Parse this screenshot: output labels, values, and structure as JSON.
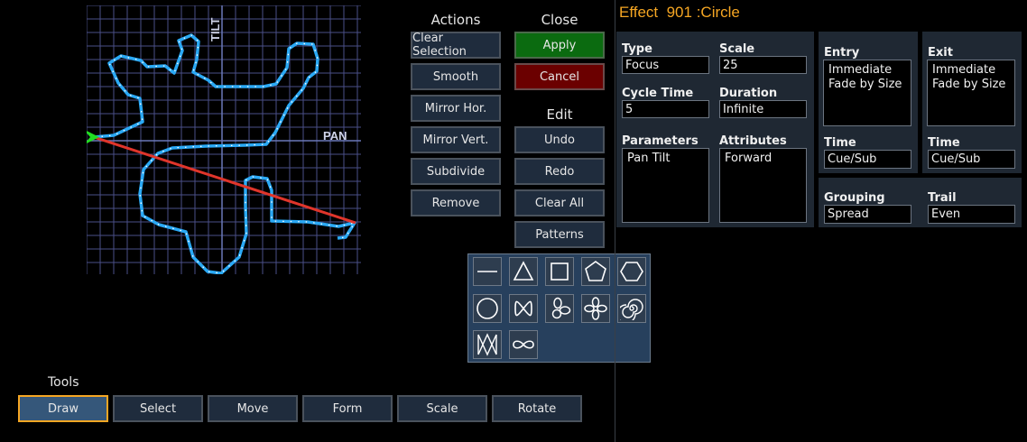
{
  "grid": {
    "tilt_label": "TILT",
    "pan_label": "PAN"
  },
  "actions": {
    "title": "Actions",
    "buttons": [
      "Clear Selection",
      "Smooth",
      "Mirror Hor.",
      "Mirror Vert.",
      "Subdivide",
      "Remove"
    ]
  },
  "close": {
    "title": "Close",
    "apply": "Apply",
    "cancel": "Cancel"
  },
  "edit": {
    "title": "Edit",
    "buttons": [
      "Undo",
      "Redo",
      "Clear All",
      "Patterns"
    ]
  },
  "patterns": {
    "icons": [
      "line-icon",
      "triangle-icon",
      "square-icon",
      "pentagon-icon",
      "hexagon-icon",
      "circle-icon",
      "figure-eight-icon",
      "three-petal-icon",
      "four-petal-icon",
      "spiral-icon",
      "zigzag-icon",
      "infinity-icon"
    ]
  },
  "tools": {
    "title": "Tools",
    "buttons": [
      "Draw",
      "Select",
      "Move",
      "Form",
      "Scale",
      "Rotate"
    ],
    "active": "Draw"
  },
  "effect": {
    "title": "Effect  901 :Circle",
    "type_label": "Type",
    "type_value": "Focus",
    "scale_label": "Scale",
    "scale_value": "25",
    "cycle_label": "Cycle Time",
    "cycle_value": "5",
    "duration_label": "Duration",
    "duration_value": "Infinite",
    "parameters_label": "Parameters",
    "parameters_value": "Pan Tilt",
    "attributes_label": "Attributes",
    "attributes_value": "Forward",
    "entry_label": "Entry",
    "entry_values": [
      "Immediate",
      "Fade by Size"
    ],
    "entry_time_label": "Time",
    "entry_time_value": "Cue/Sub",
    "exit_label": "Exit",
    "exit_values": [
      "Immediate",
      "Fade by Size"
    ],
    "exit_time_label": "Time",
    "exit_time_value": "Cue/Sub",
    "grouping_label": "Grouping",
    "grouping_value": "Spread",
    "trail_label": "Trail",
    "trail_value": "Even"
  },
  "colors": {
    "accent": "#f5a623",
    "apply": "#0b6b10",
    "cancel": "#6b0000",
    "path": "#2aa9f5",
    "direction": "#e0352b",
    "start": "#22dd22"
  }
}
